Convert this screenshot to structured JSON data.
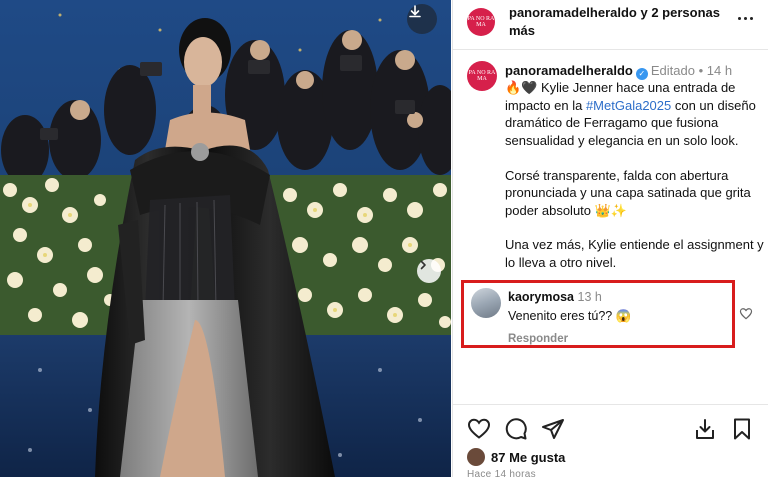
{
  "post": {
    "account": "panoramadelheraldo",
    "header_suffix": "y 2 personas más",
    "logo_text": "PA NO RA MA",
    "edited_label": "Editado",
    "time": "14 h",
    "caption_intro": "🔥🖤 Kylie Jenner hace una entrada de impacto en la",
    "hashtag": "#MetGala2025",
    "caption_rest": "con un diseño dramático de Ferragamo que fusiona sensualidad y elegancia en un solo look.",
    "caption_p2": "Corsé transparente, falda con abertura pronunciada y una capa satinada que grita poder absoluto 👑✨",
    "caption_p3": "Una vez más, Kylie entiende el assignment y lo lleva a otro nivel."
  },
  "comment": {
    "user": "kaorymosa",
    "time": "13 h",
    "text": "Venenito eres tú?? 😱",
    "reply_label": "Responder"
  },
  "footer": {
    "likes": "87 Me gusta",
    "time_ago": "Hace 14 horas"
  },
  "icons": {
    "download": "download-icon",
    "next": "chevron-right-icon",
    "more": "more-options-icon",
    "like": "heart-icon",
    "comment": "comment-icon",
    "share": "send-icon",
    "save_to": "download-icon",
    "bookmark": "bookmark-icon"
  },
  "colors": {
    "accent": "#2d6ec9",
    "brand": "#d6204b",
    "highlight_box": "#d81c1c",
    "verified": "#3897f0"
  }
}
